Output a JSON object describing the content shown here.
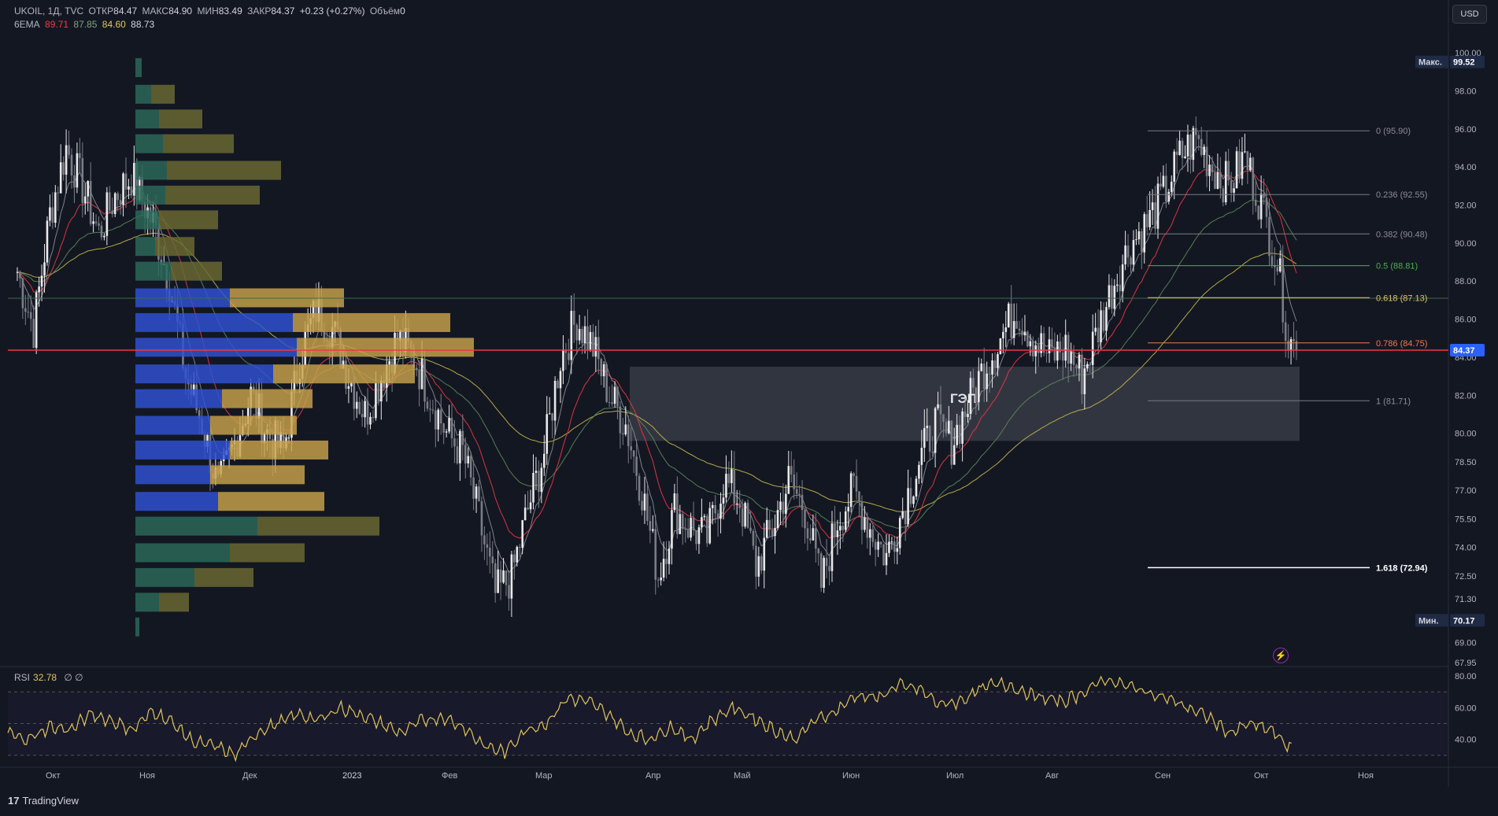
{
  "header": {
    "symbol": "UKOIL, 1Д, TVC",
    "open_label": "ОТКР",
    "open": "84.47",
    "high_label": "МАКС",
    "high": "84.90",
    "low_label": "МИН",
    "low": "83.49",
    "close_label": "ЗАКР",
    "close": "84.37",
    "change": "+0.23 (+0.27%)",
    "volume_label": "Объём",
    "volume": "0",
    "ema_label": "6EMA",
    "ema_values": [
      "89.71",
      "87.85",
      "84.60",
      "88.73"
    ]
  },
  "currency_button": "USD",
  "rsi": {
    "label": "RSI",
    "value": "32.78",
    "extra": "∅ ∅"
  },
  "brand": {
    "name": "TradingView",
    "logo_glyph": "17"
  },
  "colors": {
    "background": "#131722",
    "up_candle": "#e9e9ea",
    "down_candle": "#7a7d85",
    "ema_fast": "#f23645",
    "ema_mid": "#5d8a58",
    "ema_slow": "#c8b84a",
    "ema_micro": "#8a8d94",
    "support_line": "#f23645",
    "volume_profile_blue": "#2f52d6",
    "volume_profile_gold": "#c9a24a",
    "volume_profile_teal": "#2c6a5a",
    "volume_profile_olive": "#6b6a32",
    "rsi_line": "#e0c55a"
  },
  "chart_data": {
    "type": "candlestick",
    "y_ticks": [
      "100.00",
      "98.00",
      "96.00",
      "94.00",
      "92.00",
      "90.00",
      "88.00",
      "86.00",
      "84.00",
      "82.00",
      "80.00",
      "78.50",
      "77.00",
      "75.50",
      "74.00",
      "72.50",
      "71.30",
      "69.00",
      "67.95"
    ],
    "y_range": [
      67.95,
      100.5
    ],
    "x_ticks": [
      "Окт",
      "Ноя",
      "Дек",
      "2023",
      "Фев",
      "Мар",
      "Апр",
      "Май",
      "Июн",
      "Июл",
      "Авг",
      "Сен",
      "Окт",
      "Ноя"
    ],
    "max_label": "Макс.",
    "max_value": "99.52",
    "min_label": "Мин.",
    "min_value": "70.17",
    "last_price": "84.37",
    "support_level": 84.37,
    "gap_zone": {
      "label": "ГЭП",
      "from": 79.6,
      "to": 83.5
    },
    "fibonacci": [
      {
        "level": "0",
        "price": "95.90",
        "text": "0 (95.90)"
      },
      {
        "level": "0.236",
        "price": "92.55",
        "text": "0.236 (92.55)"
      },
      {
        "level": "0.382",
        "price": "90.48",
        "text": "0.382 (90.48)"
      },
      {
        "level": "0.5",
        "price": "88.81",
        "text": "0.5 (88.81)"
      },
      {
        "level": "0.618",
        "price": "87.13",
        "text": "0.618 (87.13)"
      },
      {
        "level": "0.786",
        "price": "84.75",
        "text": "0.786 (84.75)"
      },
      {
        "level": "1",
        "price": "81.71",
        "text": "1 (81.71)"
      },
      {
        "level": "1.618",
        "price": "72.94",
        "text": "1.618 (72.94)"
      }
    ],
    "price_path": [
      [
        0,
        88.5
      ],
      [
        6,
        85.5
      ],
      [
        12,
        91.5
      ],
      [
        18,
        95.0
      ],
      [
        24,
        93.0
      ],
      [
        30,
        90.5
      ],
      [
        36,
        92.5
      ],
      [
        42,
        93.5
      ],
      [
        50,
        91.0
      ],
      [
        56,
        88.0
      ],
      [
        62,
        83.0
      ],
      [
        68,
        80.5
      ],
      [
        74,
        77.0
      ],
      [
        80,
        79.5
      ],
      [
        86,
        82.0
      ],
      [
        92,
        80.0
      ],
      [
        98,
        79.0
      ],
      [
        104,
        84.0
      ],
      [
        110,
        86.5
      ],
      [
        116,
        85.5
      ],
      [
        122,
        83.0
      ],
      [
        128,
        81.0
      ],
      [
        134,
        83.0
      ],
      [
        140,
        85.0
      ],
      [
        146,
        84.0
      ],
      [
        152,
        82.0
      ],
      [
        158,
        80.0
      ],
      [
        164,
        79.0
      ],
      [
        170,
        75.5
      ],
      [
        176,
        71.5
      ],
      [
        182,
        72.5
      ],
      [
        188,
        76.0
      ],
      [
        194,
        79.0
      ],
      [
        200,
        84.0
      ],
      [
        206,
        86.0
      ],
      [
        212,
        84.5
      ],
      [
        218,
        82.0
      ],
      [
        224,
        80.5
      ],
      [
        230,
        77.0
      ],
      [
        236,
        72.5
      ],
      [
        242,
        76.0
      ],
      [
        248,
        75.0
      ],
      [
        254,
        74.5
      ],
      [
        260,
        77.5
      ],
      [
        266,
        76.5
      ],
      [
        272,
        73.0
      ],
      [
        278,
        75.0
      ],
      [
        284,
        77.5
      ],
      [
        290,
        76.0
      ],
      [
        296,
        72.0
      ],
      [
        302,
        75.5
      ],
      [
        308,
        77.0
      ],
      [
        314,
        75.0
      ],
      [
        320,
        73.5
      ],
      [
        326,
        76.0
      ],
      [
        332,
        78.5
      ],
      [
        338,
        80.5
      ],
      [
        344,
        79.5
      ],
      [
        350,
        81.5
      ],
      [
        356,
        83.5
      ],
      [
        362,
        85.0
      ],
      [
        368,
        86.5
      ],
      [
        374,
        85.0
      ],
      [
        380,
        84.0
      ],
      [
        386,
        84.5
      ],
      [
        392,
        83.0
      ],
      [
        398,
        85.5
      ],
      [
        404,
        88.0
      ],
      [
        410,
        90.0
      ],
      [
        416,
        91.0
      ],
      [
        422,
        92.5
      ],
      [
        428,
        94.5
      ],
      [
        434,
        95.5
      ],
      [
        440,
        94.0
      ],
      [
        446,
        93.0
      ],
      [
        452,
        94.5
      ],
      [
        458,
        92.0
      ],
      [
        464,
        89.0
      ],
      [
        468,
        85.0
      ],
      [
        471,
        84.37
      ]
    ],
    "n_days": 472,
    "rsi_range": [
      25,
      82
    ],
    "rsi_ticks": [
      "80.00",
      "60.00",
      "40.00"
    ],
    "rsi_levels": [
      70,
      50,
      30
    ],
    "rsi_path": [
      [
        0,
        44
      ],
      [
        10,
        40
      ],
      [
        20,
        48
      ],
      [
        30,
        46
      ],
      [
        40,
        56
      ],
      [
        50,
        52
      ],
      [
        60,
        46
      ],
      [
        70,
        58
      ],
      [
        80,
        50
      ],
      [
        90,
        38
      ],
      [
        100,
        36
      ],
      [
        110,
        30
      ],
      [
        120,
        44
      ],
      [
        130,
        50
      ],
      [
        140,
        56
      ],
      [
        150,
        52
      ],
      [
        160,
        60
      ],
      [
        170,
        56
      ],
      [
        180,
        50
      ],
      [
        190,
        44
      ],
      [
        200,
        52
      ],
      [
        210,
        54
      ],
      [
        220,
        48
      ],
      [
        230,
        36
      ],
      [
        240,
        32
      ],
      [
        250,
        46
      ],
      [
        260,
        50
      ],
      [
        270,
        66
      ],
      [
        280,
        64
      ],
      [
        290,
        56
      ],
      [
        300,
        44
      ],
      [
        310,
        40
      ],
      [
        320,
        48
      ],
      [
        330,
        40
      ],
      [
        340,
        52
      ],
      [
        350,
        60
      ],
      [
        360,
        54
      ],
      [
        370,
        46
      ],
      [
        380,
        40
      ],
      [
        390,
        52
      ],
      [
        400,
        58
      ],
      [
        410,
        68
      ],
      [
        420,
        66
      ],
      [
        430,
        74
      ],
      [
        440,
        72
      ],
      [
        450,
        62
      ],
      [
        460,
        64
      ],
      [
        470,
        72
      ],
      [
        480,
        76
      ],
      [
        490,
        70
      ],
      [
        500,
        66
      ],
      [
        510,
        64
      ],
      [
        520,
        70
      ],
      [
        530,
        78
      ],
      [
        540,
        74
      ],
      [
        550,
        70
      ],
      [
        560,
        66
      ],
      [
        570,
        60
      ],
      [
        580,
        54
      ],
      [
        590,
        44
      ],
      [
        600,
        50
      ],
      [
        610,
        46
      ],
      [
        620,
        34
      ]
    ],
    "volume_profile": [
      {
        "price": 99.2,
        "blue": 0,
        "gold": 0,
        "teal": 8,
        "olive": 0
      },
      {
        "price": 97.8,
        "blue": 0,
        "gold": 0,
        "teal": 20,
        "olive": 30
      },
      {
        "price": 96.5,
        "blue": 0,
        "gold": 0,
        "teal": 30,
        "olive": 55
      },
      {
        "price": 95.2,
        "blue": 0,
        "gold": 0,
        "teal": 35,
        "olive": 90
      },
      {
        "price": 93.8,
        "blue": 0,
        "gold": 0,
        "teal": 40,
        "olive": 145
      },
      {
        "price": 92.5,
        "blue": 0,
        "gold": 0,
        "teal": 38,
        "olive": 120
      },
      {
        "price": 91.2,
        "blue": 0,
        "gold": 0,
        "teal": 30,
        "olive": 75
      },
      {
        "price": 89.8,
        "blue": 0,
        "gold": 0,
        "teal": 25,
        "olive": 50
      },
      {
        "price": 88.5,
        "blue": 0,
        "gold": 0,
        "teal": 45,
        "olive": 65
      },
      {
        "price": 87.1,
        "blue": 120,
        "gold": 145,
        "teal": 0,
        "olive": 0
      },
      {
        "price": 85.8,
        "blue": 200,
        "gold": 200,
        "teal": 0,
        "olive": 0
      },
      {
        "price": 84.5,
        "blue": 205,
        "gold": 225,
        "teal": 0,
        "olive": 0
      },
      {
        "price": 83.1,
        "blue": 175,
        "gold": 180,
        "teal": 0,
        "olive": 0
      },
      {
        "price": 81.8,
        "blue": 110,
        "gold": 115,
        "teal": 0,
        "olive": 0
      },
      {
        "price": 80.4,
        "blue": 95,
        "gold": 110,
        "teal": 0,
        "olive": 0
      },
      {
        "price": 79.1,
        "blue": 120,
        "gold": 125,
        "teal": 0,
        "olive": 0
      },
      {
        "price": 77.8,
        "blue": 95,
        "gold": 120,
        "teal": 0,
        "olive": 0
      },
      {
        "price": 76.4,
        "blue": 105,
        "gold": 135,
        "teal": 0,
        "olive": 0
      },
      {
        "price": 75.1,
        "blue": 0,
        "gold": 0,
        "teal": 155,
        "olive": 155
      },
      {
        "price": 73.7,
        "blue": 0,
        "gold": 0,
        "teal": 120,
        "olive": 95
      },
      {
        "price": 72.4,
        "blue": 0,
        "gold": 0,
        "teal": 75,
        "olive": 75
      },
      {
        "price": 71.1,
        "blue": 0,
        "gold": 0,
        "teal": 30,
        "olive": 38
      },
      {
        "price": 69.8,
        "blue": 0,
        "gold": 0,
        "teal": 5,
        "olive": 0
      }
    ]
  }
}
